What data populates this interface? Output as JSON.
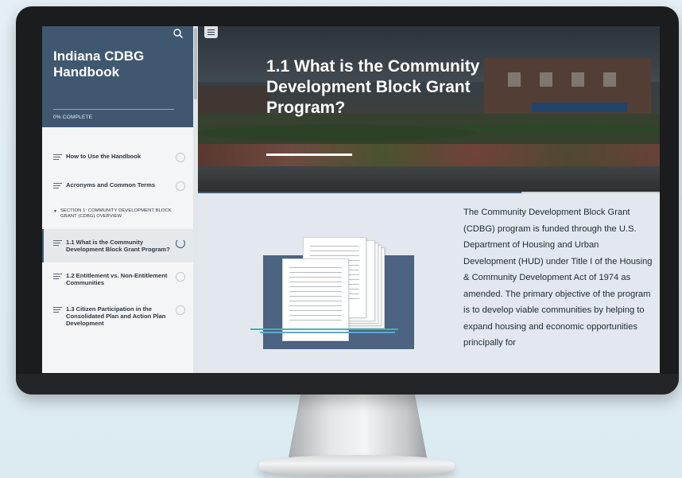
{
  "sidebar": {
    "course_title": "Indiana CDBG Handbook",
    "progress_label": "0% COMPLETE",
    "progress_percent": 0,
    "items": [
      {
        "label": "How to Use the Handbook",
        "status": "not-started"
      },
      {
        "label": "Acronyms and Common Terms",
        "status": "not-started"
      }
    ],
    "section": {
      "label": "SECTION 1: COMMUNITY DEVELOPMENT BLOCK GRANT (CDBG) OVERVIEW"
    },
    "section_items": [
      {
        "label": "1.1 What is the Community Development Block Grant Program?",
        "status": "in-progress",
        "active": true
      },
      {
        "label": "1.2 Entitlement vs. Non-Entitlement Communities",
        "status": "not-started"
      },
      {
        "label": "1.3 Citizen Participation in the Consolidated Plan and Action Plan Development",
        "status": "not-started"
      }
    ]
  },
  "lesson": {
    "title": "1.1 What is the Community Development Block Grant Program?",
    "body": "The Community Development Block Grant (CDBG) program is funded through the U.S. Department of Housing and Urban Development (HUD) under Title I of the Housing & Community Development Act of 1974 as amended. The primary objective of the program is to develop viable communities by helping to expand housing and economic opportunities principally for"
  },
  "colors": {
    "sidebar_header": "#3f5870",
    "accent": "#3f5870",
    "body_background": "#e2e8ee",
    "teal_accent": "#3cb5b0"
  },
  "icons": [
    "search-icon",
    "menu-icon",
    "list-icon",
    "status-circle-icon",
    "caret-down-icon"
  ]
}
